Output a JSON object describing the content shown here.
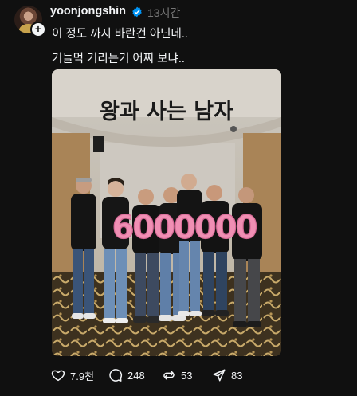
{
  "post": {
    "username": "yoonjongshin",
    "time": "13시간",
    "text_line1": "이 정도 까지 바란건 아닌데..",
    "text_line2": "거들먹 거리는거 어찌 보냐..",
    "image": {
      "wall_text": "왕과 사는 남자",
      "balloon_text": "6000000"
    }
  },
  "actions": {
    "likes": "7.9천",
    "replies": "248",
    "reposts": "53",
    "shares": "83"
  },
  "colors": {
    "background": "#101010",
    "text": "#f3f5f7",
    "muted": "#777777",
    "verified": "#0095f6",
    "balloon": "#f08fb4"
  },
  "icons": [
    "avatar",
    "follow-plus-icon",
    "verified-icon",
    "heart-icon",
    "comment-icon",
    "repost-icon",
    "share-icon"
  ]
}
